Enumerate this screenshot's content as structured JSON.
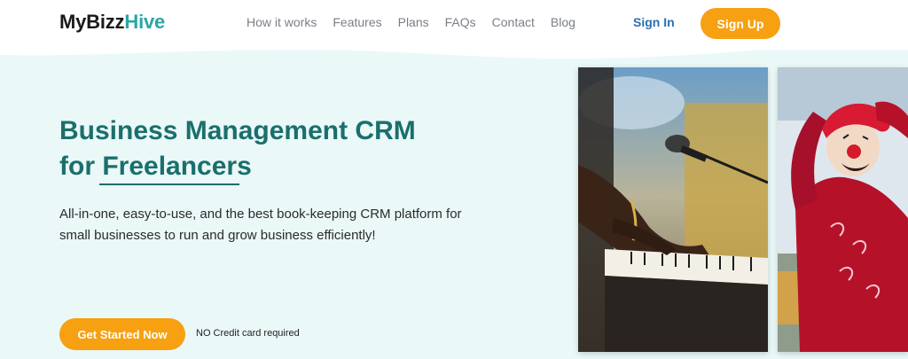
{
  "brand": {
    "name_main": "MyBizz",
    "name_accent": "Hive"
  },
  "nav": {
    "items": [
      "How it works",
      "Features",
      "Plans",
      "FAQs",
      "Contact",
      "Blog"
    ]
  },
  "auth": {
    "sign_in": "Sign In",
    "sign_up": "Sign Up"
  },
  "hero": {
    "headline_line1": "Business Management CRM",
    "headline_for": "for ",
    "headline_strong": "Freelancers",
    "description": "All-in-one, easy-to-use, and the best book-keeping CRM platform for small businesses to run and grow business efficiently!",
    "cta_label": "Get Started Now",
    "cta_note": "NO Credit card required"
  },
  "colors": {
    "accent_orange": "#f7a011",
    "teal_text": "#1a6f6c",
    "hero_bg": "#eaf8f8",
    "link_blue": "#2a6fb0"
  },
  "images": [
    {
      "name": "musician-photo"
    },
    {
      "name": "clown-photo"
    }
  ]
}
